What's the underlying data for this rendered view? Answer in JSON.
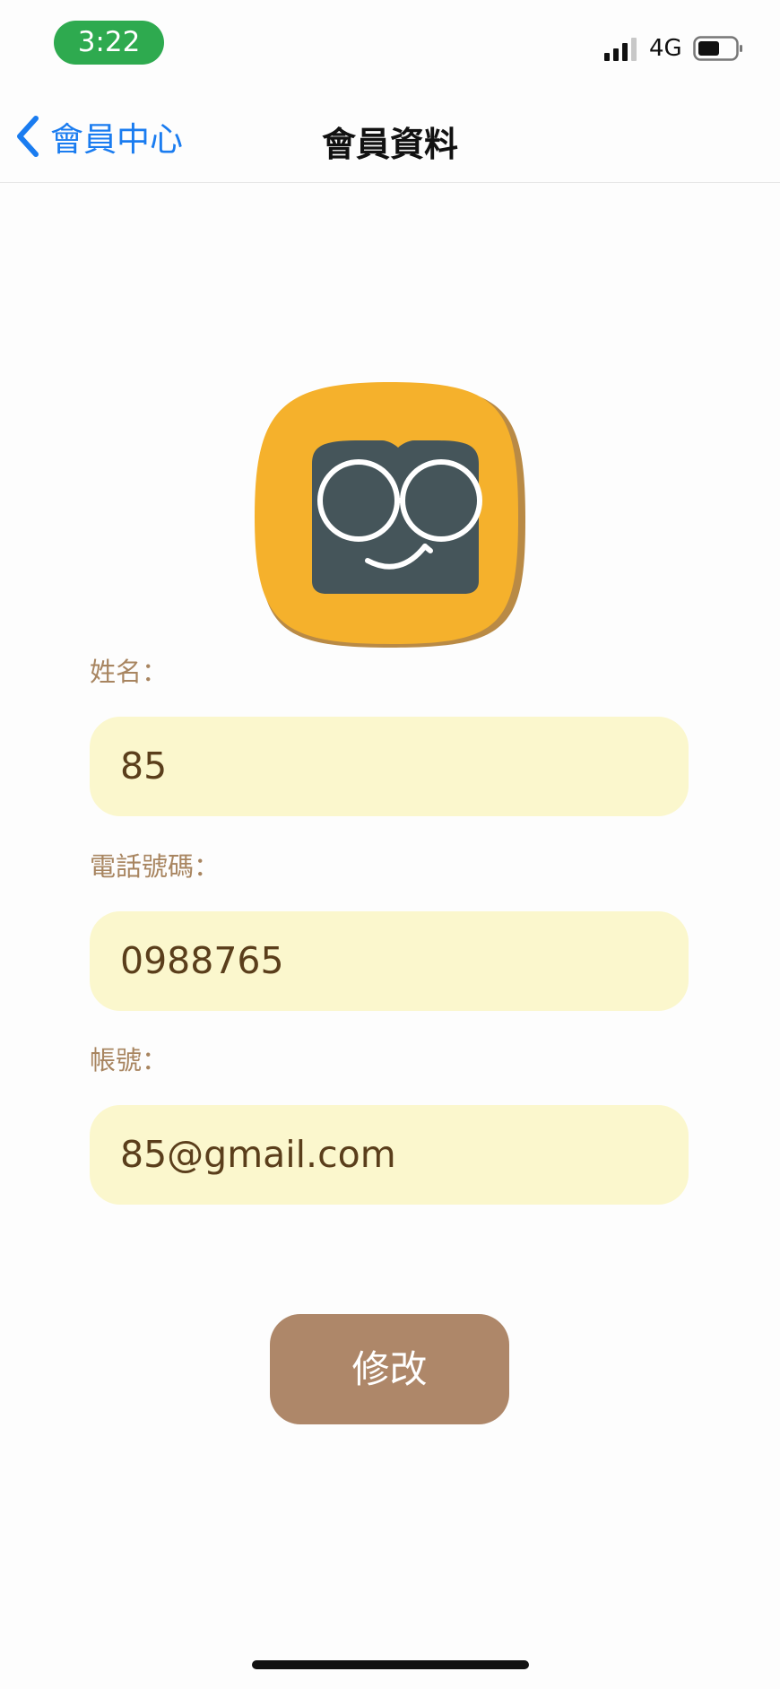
{
  "status": {
    "time": "3:22",
    "network": "4G"
  },
  "nav": {
    "back_label": "會員中心",
    "title": "會員資料"
  },
  "form": {
    "name": {
      "label": "姓名：",
      "value": "85"
    },
    "phone": {
      "label": "電話號碼：",
      "value": "0988765"
    },
    "account": {
      "label": "帳號：",
      "value": "85@gmail.com"
    },
    "submit_label": "修改"
  },
  "colors": {
    "accent": "#1a7cf0",
    "time_pill": "#2eaa4f",
    "field_bg": "#fbf7cd",
    "label_text": "#a88560",
    "button_bg": "#ae8769",
    "avatar_bg": "#f5b12c"
  },
  "icons": [
    "chevron-left-icon",
    "signal-icon",
    "battery-icon",
    "glasses-face-avatar-icon"
  ]
}
